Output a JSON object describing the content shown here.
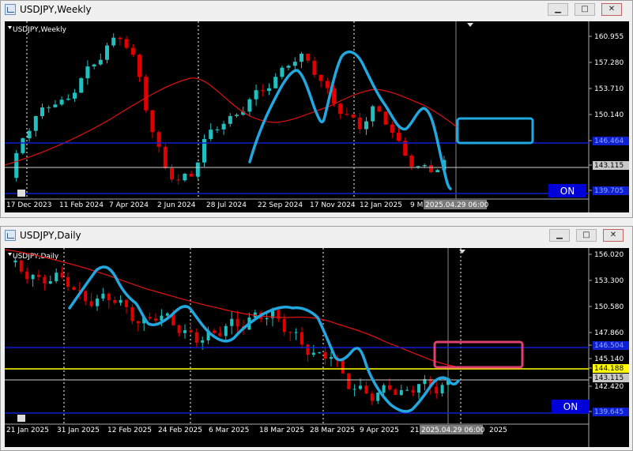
{
  "windows": [
    {
      "title": "USDJPY,Weekly",
      "chart_label": "USDJPY,Weekly",
      "on_label": "ON",
      "prices": [
        "160.955",
        "157.280",
        "153.710",
        "150.140",
        "146.464",
        "143.115",
        "139.705"
      ],
      "dates": [
        "17 Dec 2023",
        "11 Feb 2024",
        "7 Apr 2024",
        "2 Jun 2024",
        "28 Jul 2024",
        "22 Sep 2024",
        "17 Nov 2024",
        "12 Jan 2025",
        "9 M",
        "2025.04.29 06:00"
      ],
      "highlight_prices": {
        "blue_line": "146.464",
        "current": "143.115",
        "bottom": "139.705"
      }
    },
    {
      "title": "USDJPY,Daily",
      "chart_label": "USDJPY,Daily",
      "on_label": "ON",
      "prices": [
        "156.020",
        "153.300",
        "150.580",
        "147.860",
        "146.504",
        "145.140",
        "144.188",
        "143.115",
        "142.420",
        "139.645"
      ],
      "dates": [
        "21 Jan 2025",
        "31 Jan 2025",
        "12 Feb 2025",
        "24 Feb 2025",
        "6 Mar 2025",
        "18 Mar 2025",
        "28 Mar 2025",
        "9 Apr 2025",
        "21",
        "2025.04.29 06:00",
        "2025"
      ],
      "highlight_prices": {
        "blue_line": "146.504",
        "yellow_line": "144.188",
        "current": "143.115",
        "bottom": "139.645"
      }
    }
  ],
  "window_buttons": {
    "minimize": "▁",
    "maximize": "□",
    "close": "✕"
  },
  "colors": {
    "bull": "#20c0c0",
    "bear": "#e00000",
    "ma": "#e01010",
    "hline": "#1020d0",
    "yellow": "#ffff00",
    "drawing": "#22a8e0",
    "rect_weekly": "#22a8e0",
    "rect_daily": "#e04070"
  }
}
